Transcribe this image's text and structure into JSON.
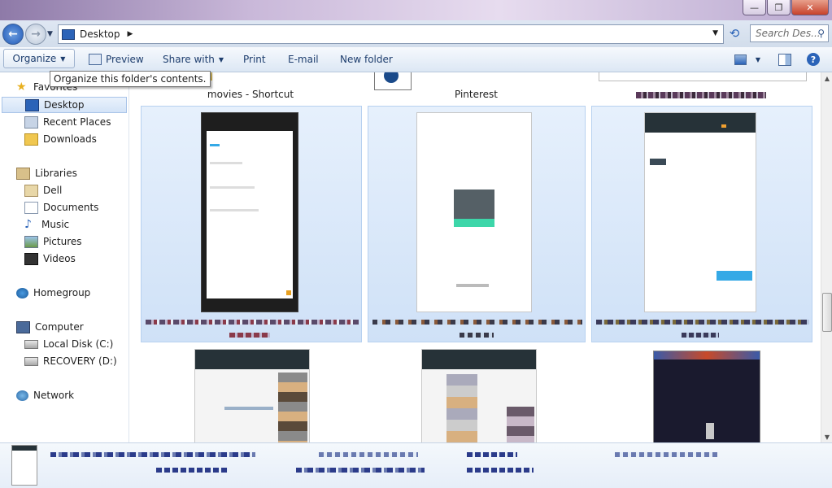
{
  "window": {
    "minimize": "—",
    "maximize": "❐",
    "close": "✕"
  },
  "address": {
    "path": "Desktop",
    "search_placeholder": "Search Des..."
  },
  "toolbar": {
    "organize": "Organize",
    "preview": "Preview",
    "share_with": "Share with",
    "print": "Print",
    "email": "E-mail",
    "new_folder": "New folder"
  },
  "tooltip": "Organize this folder's contents.",
  "sidebar": {
    "favorites": "Favorites",
    "desktop": "Desktop",
    "recent": "Recent Places",
    "downloads": "Downloads",
    "libraries": "Libraries",
    "dell": "Dell",
    "documents": "Documents",
    "music": "Music",
    "pictures": "Pictures",
    "videos": "Videos",
    "homegroup": "Homegroup",
    "computer": "Computer",
    "local_disk": "Local Disk (C:)",
    "recovery": "RECOVERY (D:)",
    "network": "Network"
  },
  "files": {
    "movies_shortcut": "movies - Shortcut",
    "pinterest": "Pinterest"
  },
  "colors": {
    "selection": "#cfe1f7",
    "accent": "#2b63b8",
    "teal": "#3dd6a9"
  }
}
